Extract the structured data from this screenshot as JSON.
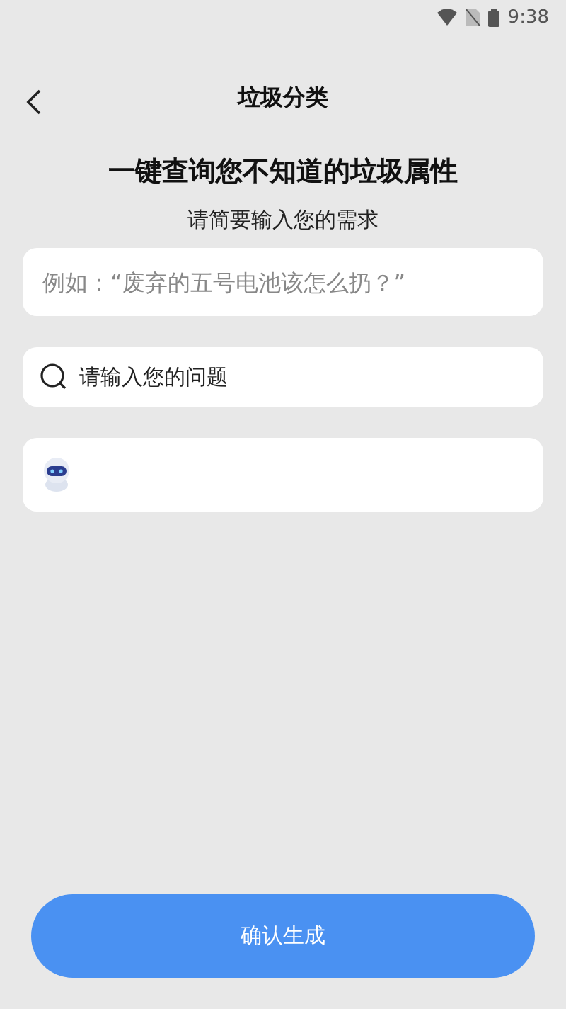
{
  "status_bar": {
    "time": "9:38"
  },
  "header": {
    "title": "垃圾分类"
  },
  "headline": "一键查询您不知道的垃圾属性",
  "subtitle": "请简要输入您的需求",
  "input": {
    "placeholder": "例如：“废弃的五号电池该怎么扔？”"
  },
  "search": {
    "placeholder": "请输入您的问题"
  },
  "buttons": [
    "确认生成"
  ]
}
